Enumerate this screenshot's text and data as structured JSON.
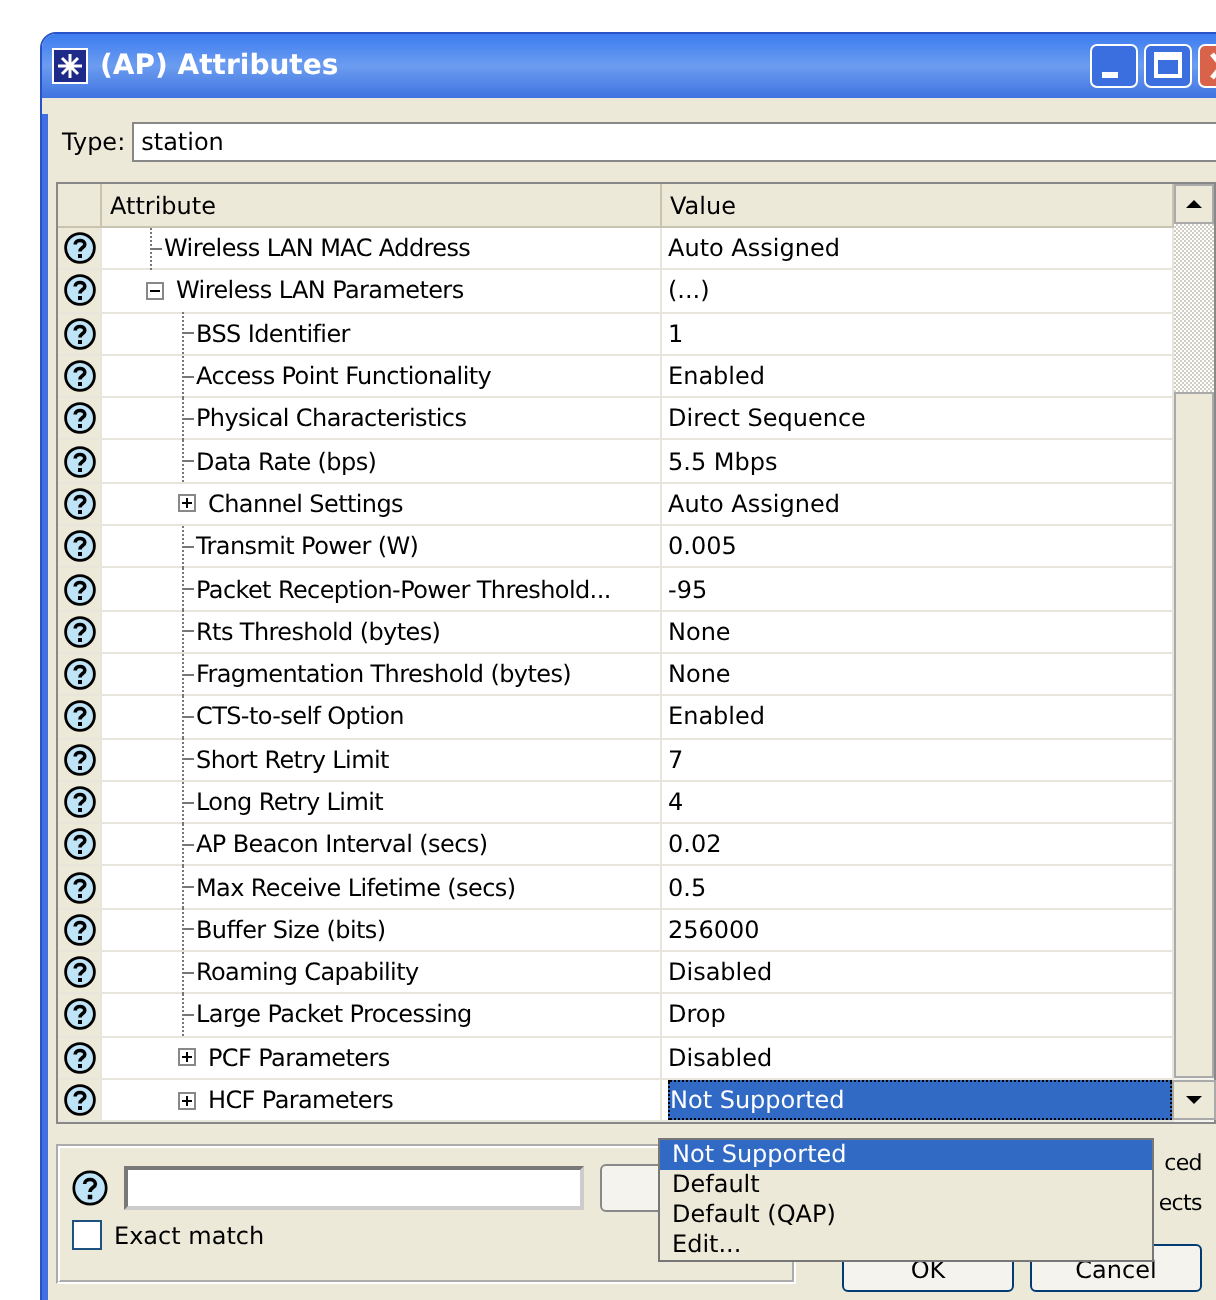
{
  "window": {
    "title": "(AP) Attributes"
  },
  "type_field": {
    "label": "Type:",
    "value": "station"
  },
  "table": {
    "columns": [
      "Attribute",
      "Value"
    ],
    "rows": [
      {
        "attribute": "Wireless LAN MAC Address",
        "value": "Auto Assigned",
        "selected": false
      },
      {
        "attribute": "Wireless LAN Parameters",
        "value": "(...)",
        "selected": false,
        "expanded": true,
        "children": [
          {
            "attribute": "BSS Identifier",
            "value": "1",
            "selected": false
          },
          {
            "attribute": "Access Point Functionality",
            "value": "Enabled",
            "selected": false
          },
          {
            "attribute": "Physical Characteristics",
            "value": "Direct Sequence",
            "selected": false
          },
          {
            "attribute": "Data Rate (bps)",
            "value": "5.5 Mbps",
            "selected": false
          },
          {
            "attribute": "Channel Settings",
            "value": "Auto Assigned",
            "selected": false,
            "expanded": false
          },
          {
            "attribute": "Transmit Power (W)",
            "value": "0.005",
            "selected": false
          },
          {
            "attribute": "Packet Reception-Power Threshold...",
            "value": "-95",
            "selected": false
          },
          {
            "attribute": "Rts Threshold (bytes)",
            "value": "None",
            "selected": false
          },
          {
            "attribute": "Fragmentation Threshold (bytes)",
            "value": "None",
            "selected": false
          },
          {
            "attribute": "CTS-to-self Option",
            "value": "Enabled",
            "selected": false
          },
          {
            "attribute": "Short Retry Limit",
            "value": "7",
            "selected": false
          },
          {
            "attribute": "Long Retry Limit",
            "value": "4",
            "selected": false
          },
          {
            "attribute": "AP Beacon Interval (secs)",
            "value": "0.02",
            "selected": false
          },
          {
            "attribute": "Max Receive Lifetime (secs)",
            "value": "0.5",
            "selected": false
          },
          {
            "attribute": "Buffer Size (bits)",
            "value": "256000",
            "selected": false
          },
          {
            "attribute": "Roaming Capability",
            "value": "Disabled",
            "selected": false
          },
          {
            "attribute": "Large Packet Processing",
            "value": "Drop",
            "selected": false
          },
          {
            "attribute": "PCF Parameters",
            "value": "Disabled",
            "selected": false,
            "expanded": false
          },
          {
            "attribute": "HCF Parameters",
            "value": "Not Supported",
            "selected": true,
            "expanded": false
          }
        ]
      }
    ]
  },
  "dropdown": {
    "options": [
      {
        "label": "Not Supported",
        "selected": true
      },
      {
        "label": "Default",
        "selected": false
      },
      {
        "label": "Default (QAP)",
        "selected": false
      },
      {
        "label": "Edit...",
        "selected": false
      }
    ]
  },
  "search": {
    "exact_match": {
      "label": "Exact match",
      "checked": false
    }
  },
  "side_labels": [
    "ced",
    "ects"
  ],
  "buttons": [
    "OK",
    "Cancel"
  ]
}
